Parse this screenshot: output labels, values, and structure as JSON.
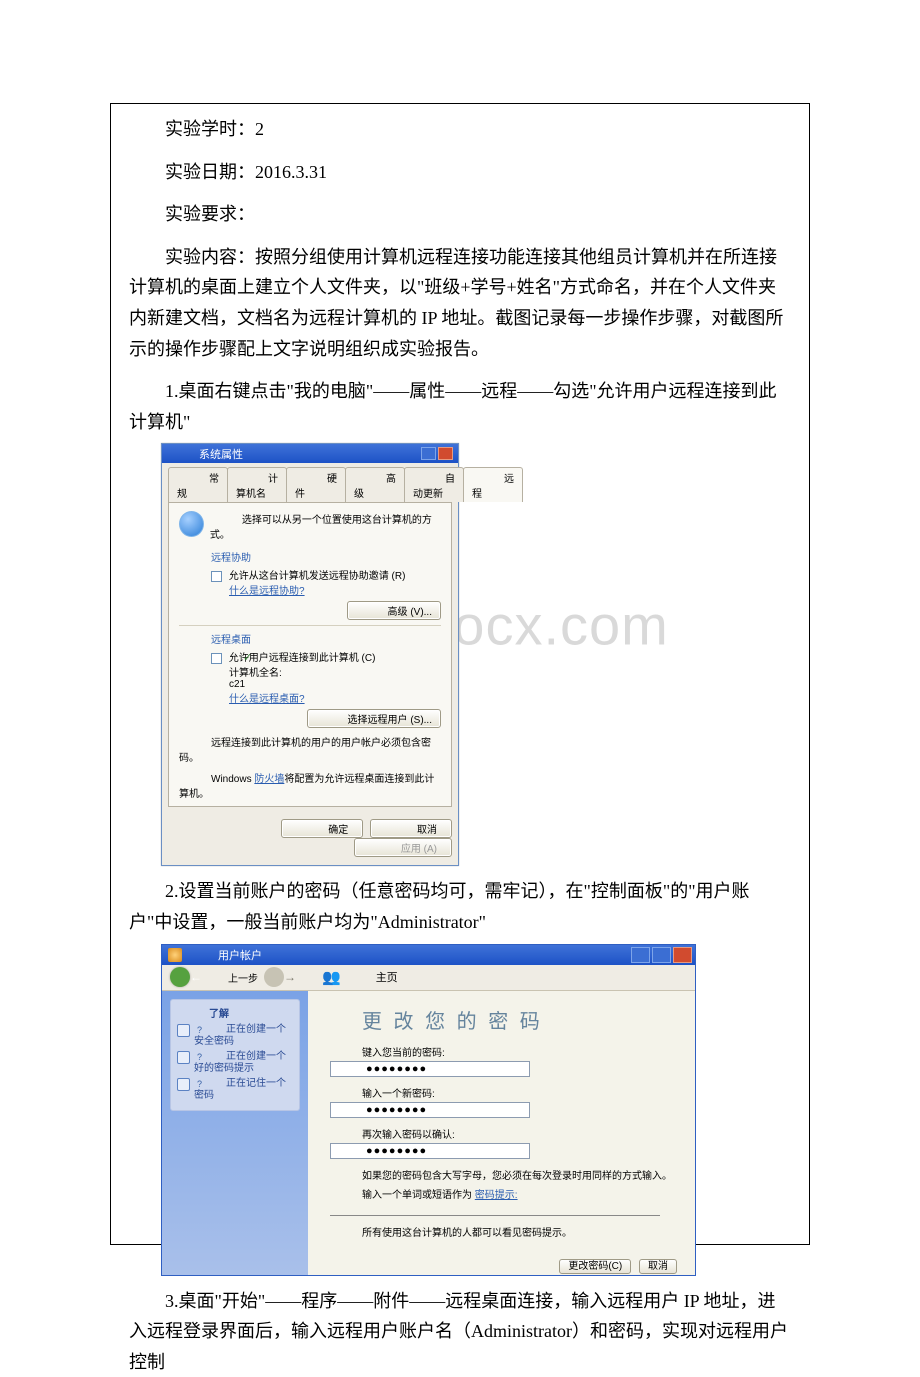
{
  "intro": {
    "hours": "实验学时：2",
    "date": "实验日期：2016.3.31",
    "requirement": "实验要求：",
    "content": "实验内容：按照分组使用计算机远程连接功能连接其他组员计算机并在所连接计算机的桌面上建立个人文件夹，以\"班级+学号+姓名\"方式命名，并在个人文件夹内新建文档，文档名为远程计算机的 IP 地址。截图记录每一步操作步骤，对截图所示的操作步骤配上文字说明组织成实验报告。",
    "step1": "1.桌面右键点击\"我的电脑\"——属性——远程——勾选\"允许用户远程连接到此计算机\"",
    "step2": "2.设置当前账户的密码（任意密码均可，需牢记），在\"控制面板\"的\"用户账户\"中设置，一般当前账户均为\"Administrator\"",
    "step3": "3.桌面\"开始\"——程序——附件——远程桌面连接，输入远程用户 IP 地址，进入远程登录界面后，输入远程用户账户名（Administrator）和密码，实现对远程用户控制"
  },
  "sysprop": {
    "title": "系统属性",
    "help": "?",
    "close": "×",
    "tabs": [
      "常规",
      "计算机名",
      "硬件",
      "高级",
      "自动更新",
      "远程"
    ],
    "active_tab": "远程",
    "intro_line": "选择可以从另一个位置使用这台计算机的方式。",
    "group1": {
      "title": "远程协助",
      "check_label": "允许从这台计算机发送远程协助邀请 (R)",
      "link": "什么是远程协助?",
      "advanced_btn": "高级 (V)..."
    },
    "group2": {
      "title": "远程桌面",
      "check_label": "允许用户远程连接到此计算机 (C)",
      "fullname_label": "计算机全名:",
      "fullname_value": "c21",
      "link": "什么是远程桌面?",
      "select_btn": "选择远程用户 (S)...",
      "pw_line": "远程连接到此计算机的用户的用户帐户必须包含密码。",
      "fw_prefix": "Windows ",
      "fw_link": "防火墙",
      "fw_suffix": "将配置为允许远程桌面连接到此计算机。"
    },
    "buttons": {
      "ok": "确定",
      "cancel": "取消",
      "apply": "应用 (A)"
    }
  },
  "useracct": {
    "title": "用户帐户",
    "toolbar": {
      "back": "上一步",
      "home": "主页"
    },
    "sidebar": {
      "title": "了解",
      "items": [
        "正在创建一个安全密码",
        "正在创建一个好的密码提示",
        "正在记住一个密码"
      ]
    },
    "main": {
      "heading": "更 改 您 的 密 码",
      "current_label": "键入您当前的密码:",
      "new_label": "输入一个新密码:",
      "confirm_label": "再次输入密码以确认:",
      "pw_mask": "●●●●●●●●",
      "note": "如果您的密码包含大写字母，您必须在每次登录时用同样的方式输入。",
      "hint_prefix": "输入一个单词或短语作为 ",
      "hint_link": "密码提示:",
      "hint_note": "所有使用这台计算机的人都可以看见密码提示。",
      "btn_change": "更改密码(C)",
      "btn_cancel": "取消"
    }
  },
  "watermark": "www.bdocx.com"
}
